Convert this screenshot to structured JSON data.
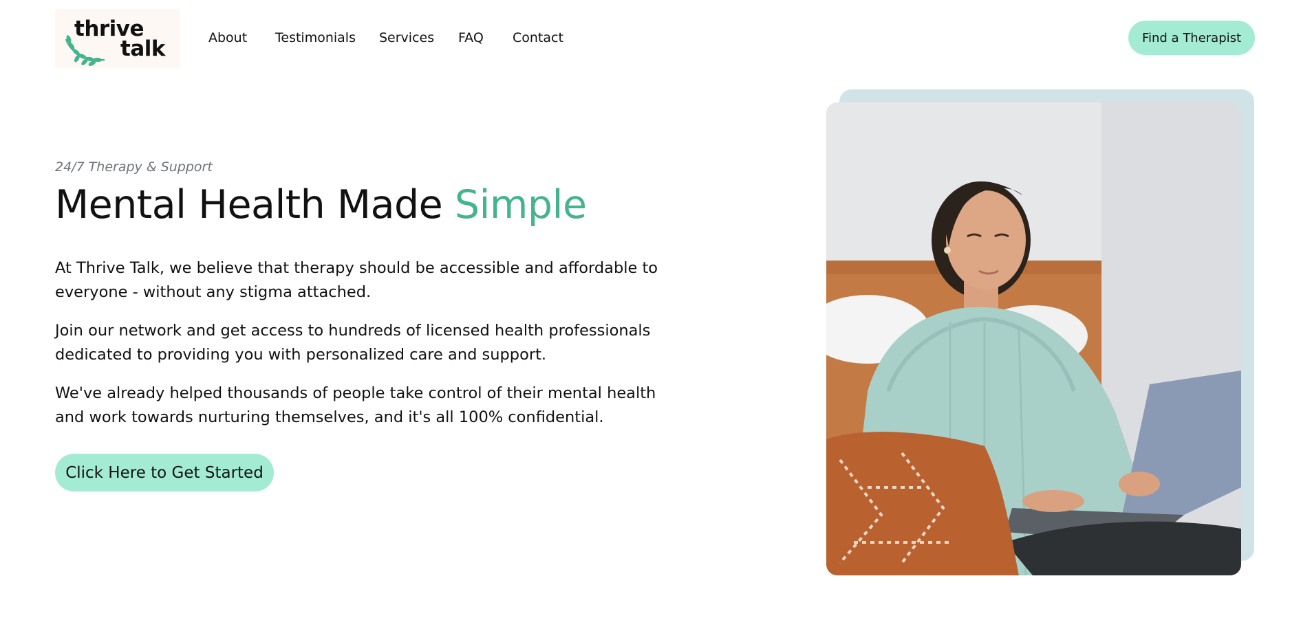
{
  "brand": {
    "line1": "thrive",
    "line2": "talk",
    "accent": "#45b38f"
  },
  "nav": {
    "items": [
      "About",
      "Testimonials",
      "Services",
      "FAQ",
      "Contact"
    ]
  },
  "header_cta": "Find a Therapist",
  "hero": {
    "eyebrow": "24/7 Therapy & Support",
    "headline": "Mental Health Made",
    "headline_accent": "Simple",
    "paragraphs": [
      "At Thrive Talk, we believe that therapy should be accessible and affordable to everyone - without any stigma attached.",
      "Join our network and get access to hundreds of licensed health professionals dedicated to providing you with personalized care and support.",
      "We've already helped thousands of people take control of their mental health and work towards nurturing themselves, and it's all 100% confidential."
    ],
    "cta": "Click Here to Get Started"
  },
  "colors": {
    "button_bg": "#a3ecd3",
    "photo_frame": "#d0e4e8",
    "eyebrow": "#6d737a"
  }
}
